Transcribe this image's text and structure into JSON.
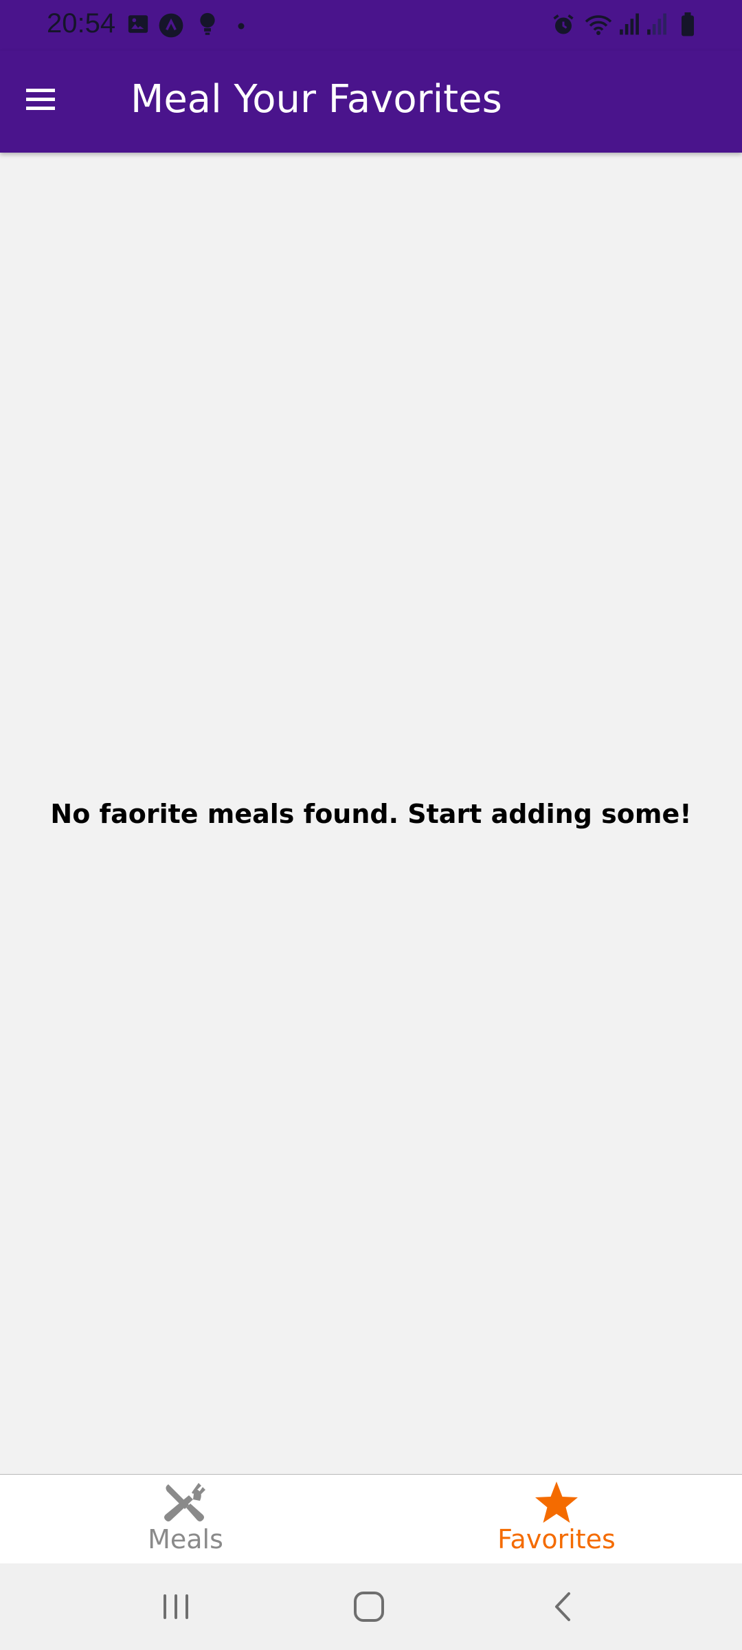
{
  "status_bar": {
    "time": "20:54",
    "left_icons": [
      "image-icon",
      "app-a-icon",
      "bulb-icon",
      "dot-icon"
    ],
    "right_icons": [
      "alarm-icon",
      "wifi-icon",
      "signal-icon",
      "signal-weak-icon",
      "battery-icon"
    ]
  },
  "app_bar": {
    "title": "Meal Your Favorites",
    "menu_icon": "hamburger-menu-icon",
    "background": "#4a148c"
  },
  "content": {
    "empty_message": "No faorite meals found. Start adding some!"
  },
  "tabs": [
    {
      "label": "Meals",
      "icon": "fork-knife-icon",
      "active": false,
      "color": "#8a8a8a"
    },
    {
      "label": "Favorites",
      "icon": "star-icon",
      "active": true,
      "color": "#f46b00"
    }
  ],
  "system_nav": {
    "buttons": [
      "recent-apps-icon",
      "home-icon",
      "back-icon"
    ]
  }
}
